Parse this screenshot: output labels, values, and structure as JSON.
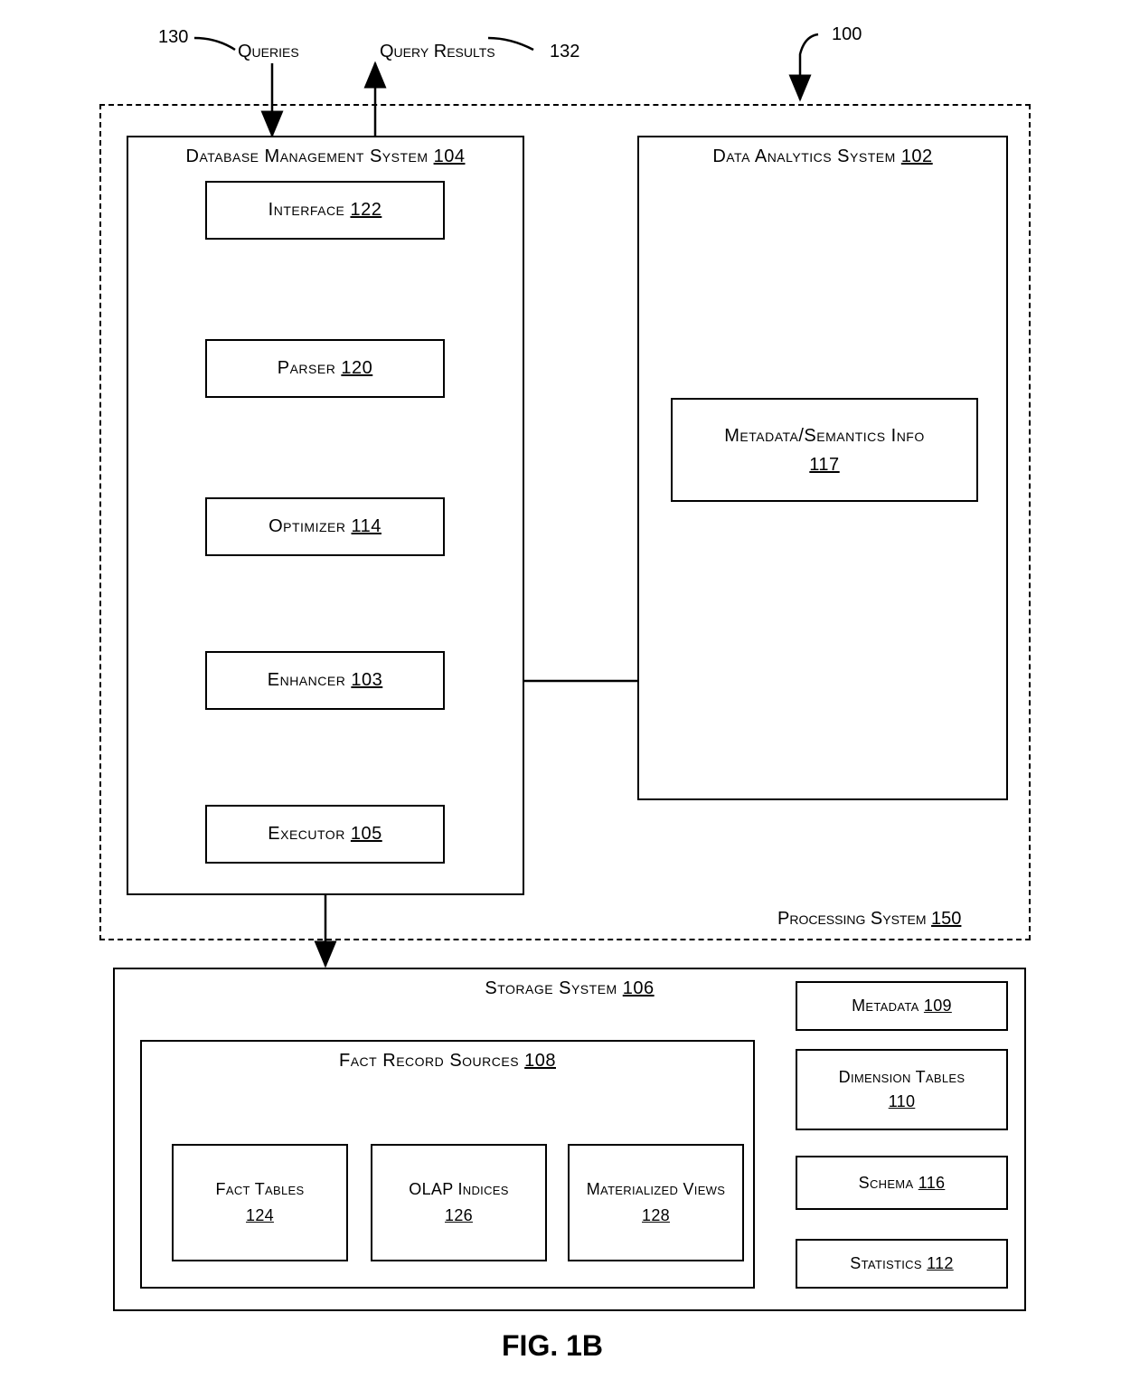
{
  "refs": {
    "r100": "100",
    "r102_title": "Data Analytics System ",
    "r102_num": "102",
    "r103_title": "Enhancer ",
    "r103_num": "103",
    "r104_title": "Database Management System ",
    "r104_num": "104",
    "r105_title": "Executor ",
    "r105_num": "105",
    "r106_title": "Storage System ",
    "r106_num": "106",
    "r108_title": "Fact Record Sources ",
    "r108_num": "108",
    "r109_title": "Metadata ",
    "r109_num": "109",
    "r110_title": "Dimension Tables ",
    "r110_num": "110",
    "r112_title": "Statistics ",
    "r112_num": "112",
    "r114_title": "Optimizer ",
    "r114_num": "114",
    "r116_title": "Schema ",
    "r116_num": "116",
    "r117_title": "Metadata/Semantics Info",
    "r117_num": "117",
    "r120_title": "Parser ",
    "r120_num": "120",
    "r122_title": "Interface ",
    "r122_num": "122",
    "r124_title": "Fact Tables ",
    "r124_num": "124",
    "r126_title": "OLAP Indices ",
    "r126_num": "126",
    "r128_title": "Materialized Views ",
    "r128_num": "128",
    "r130_num": "130",
    "r130_label": "Queries",
    "r132_num": "132",
    "r132_label": "Query Results",
    "r150_title": "Processing System ",
    "r150_num": "150"
  },
  "figure_label": "FIG. 1B"
}
